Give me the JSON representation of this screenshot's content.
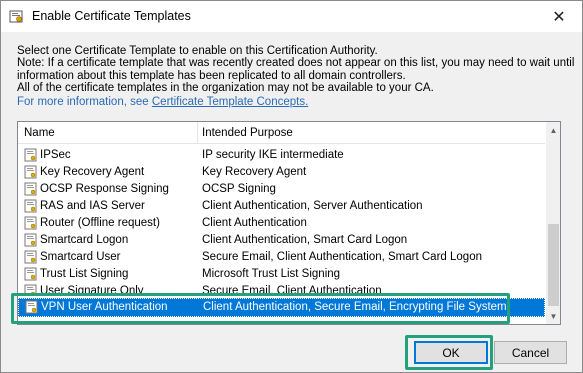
{
  "window": {
    "title": "Enable Certificate Templates",
    "close_glyph": "✕"
  },
  "intro": {
    "lines": [
      "Select one Certificate Template to enable on this Certification Authority.",
      "Note: If a certificate template that was recently created does not appear on this list, you may need to wait until",
      "information about this template has been replicated to all domain controllers.",
      "All of the certificate templates in the organization may not be available to your CA."
    ],
    "more_info_prefix": "For more information, see",
    "more_info_link": "Certificate Template Concepts."
  },
  "list": {
    "columns": [
      "Name",
      "Intended Purpose"
    ],
    "rows": [
      {
        "name": "IPSec",
        "purpose": "IP security IKE intermediate"
      },
      {
        "name": "Key Recovery Agent",
        "purpose": "Key Recovery Agent"
      },
      {
        "name": "OCSP Response Signing",
        "purpose": "OCSP Signing"
      },
      {
        "name": "RAS and IAS Server",
        "purpose": "Client Authentication, Server Authentication"
      },
      {
        "name": "Router (Offline request)",
        "purpose": "Client Authentication"
      },
      {
        "name": "Smartcard Logon",
        "purpose": "Client Authentication, Smart Card Logon"
      },
      {
        "name": "Smartcard User",
        "purpose": "Secure Email, Client Authentication, Smart Card Logon"
      },
      {
        "name": "Trust List Signing",
        "purpose": "Microsoft Trust List Signing"
      },
      {
        "name": "User Signature Only",
        "purpose": "Secure Email, Client Authentication"
      },
      {
        "name": "VPN User Authentication",
        "purpose": "Client Authentication, Secure Email, Encrypting File System",
        "selected": true
      }
    ]
  },
  "buttons": {
    "ok": "OK",
    "cancel": "Cancel"
  },
  "colors": {
    "selection": "#0078d7",
    "highlight_box": "#23a07c",
    "link": "#2a6bb5"
  }
}
